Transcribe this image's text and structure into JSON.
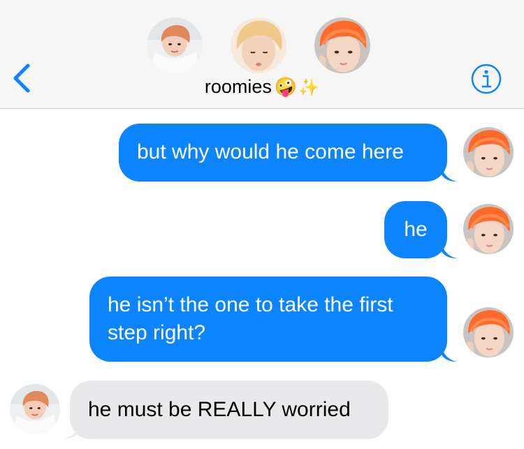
{
  "header": {
    "back_icon": "chevron-left-icon",
    "info_icon": "info-icon",
    "accent_color": "#0b84fe",
    "title": "roomies",
    "title_emoji": "🤪",
    "title_sparkle": "✨",
    "participants": [
      "avatar-blonde-tint",
      "avatar-light-hair",
      "avatar-orange-hair"
    ]
  },
  "messages": [
    {
      "direction": "sent",
      "text": "but why would he come here",
      "sender_avatar": "avatar-orange-hair"
    },
    {
      "direction": "sent",
      "text": "he",
      "sender_avatar": "avatar-orange-hair"
    },
    {
      "direction": "sent",
      "text": "he isn’t the one to take the first step right?",
      "sender_avatar": "avatar-orange-hair"
    },
    {
      "direction": "received",
      "text": "he must be REALLY worried",
      "sender_avatar": "avatar-blonde-tint"
    }
  ],
  "colors": {
    "sent_bubble": "#0b84fe",
    "received_bubble": "#e9e9eb",
    "header_bg": "#f6f6f6"
  }
}
